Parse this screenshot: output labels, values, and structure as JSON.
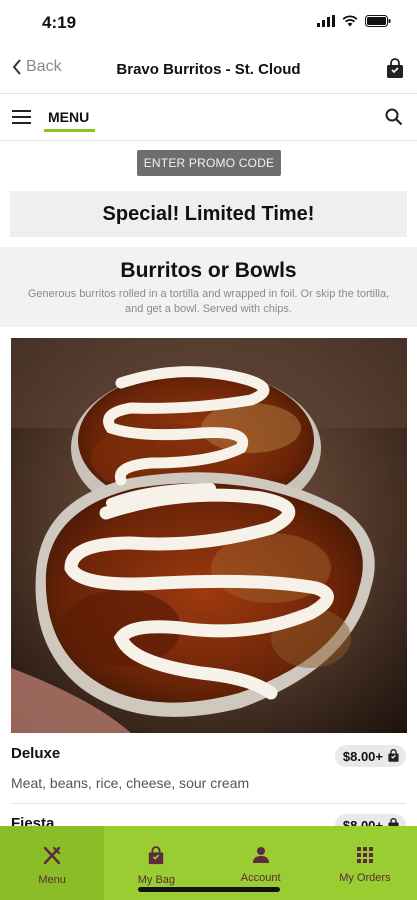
{
  "status_bar": {
    "time": "4:19"
  },
  "nav": {
    "back_label": "Back",
    "title": "Bravo Burritos - St. Cloud"
  },
  "menu_bar": {
    "tab_label": "MENU"
  },
  "promo": {
    "button_label": "ENTER PROMO CODE"
  },
  "special": {
    "label": "Special! Limited Time!"
  },
  "category": {
    "title": "Burritos or Bowls",
    "description": "Generous burritos rolled in a tortilla and wrapped in foil. Or skip the tortilla, and get a bowl. Served with chips."
  },
  "items": [
    {
      "name": "Deluxe",
      "price": "$8.00+",
      "description": "Meat, beans, rice, cheese, sour cream"
    },
    {
      "name": "Fiesta",
      "price": "$8.00+"
    }
  ],
  "tab_bar": {
    "tabs": [
      {
        "label": "Menu",
        "icon": "fork-knife-icon"
      },
      {
        "label": "My Bag",
        "icon": "bag-icon"
      },
      {
        "label": "Account",
        "icon": "person-icon"
      },
      {
        "label": "My Orders",
        "icon": "grid-icon"
      }
    ]
  },
  "colors": {
    "accent_green": "#9acd32",
    "tab_icon": "#5c2b3c",
    "promo_button": "#6e6e6e"
  }
}
